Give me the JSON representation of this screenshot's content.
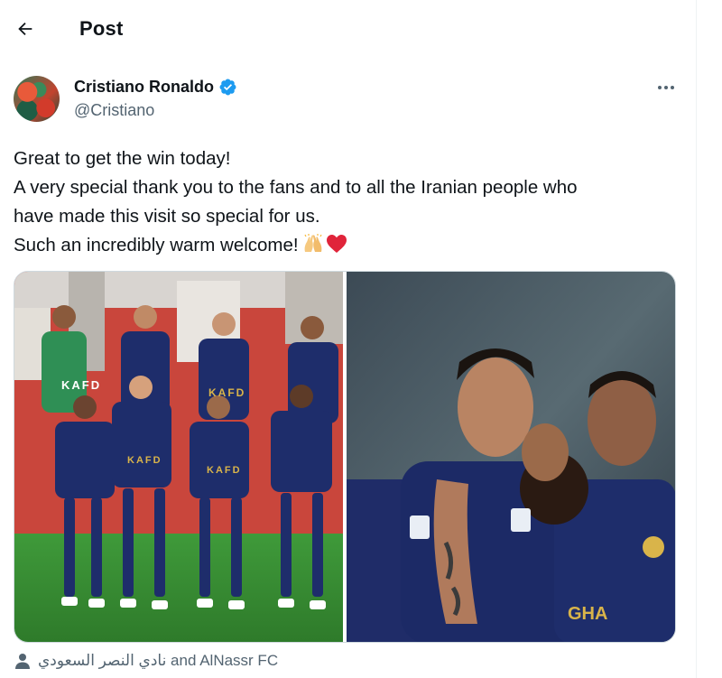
{
  "header": {
    "title": "Post",
    "back_icon": "arrow-left-icon"
  },
  "author": {
    "name": "Cristiano Ronaldo",
    "handle": "@Cristiano",
    "verified": true,
    "verified_color": "#1d9bf0"
  },
  "post": {
    "lines": [
      "Great to get the win today!",
      "A very special thank you to the fans and to all the Iranian people who",
      "have made this visit so special for us.",
      "Such an incredibly warm welcome!"
    ],
    "emojis": [
      "raising-hands-emoji",
      "red-heart-emoji"
    ]
  },
  "media": {
    "left_photo": "team-photo",
    "right_photo": "celebration-photo",
    "sponsor_text": "KAFD",
    "shirt_name": "GHA"
  },
  "tagged": {
    "text": "نادي النصر السعودي and AlNassr FC",
    "icon": "person-icon"
  },
  "colors": {
    "text_primary": "#0f1419",
    "text_secondary": "#536471",
    "kit_navy": "#1e2d6b",
    "kit_gold": "#d9b44a"
  }
}
